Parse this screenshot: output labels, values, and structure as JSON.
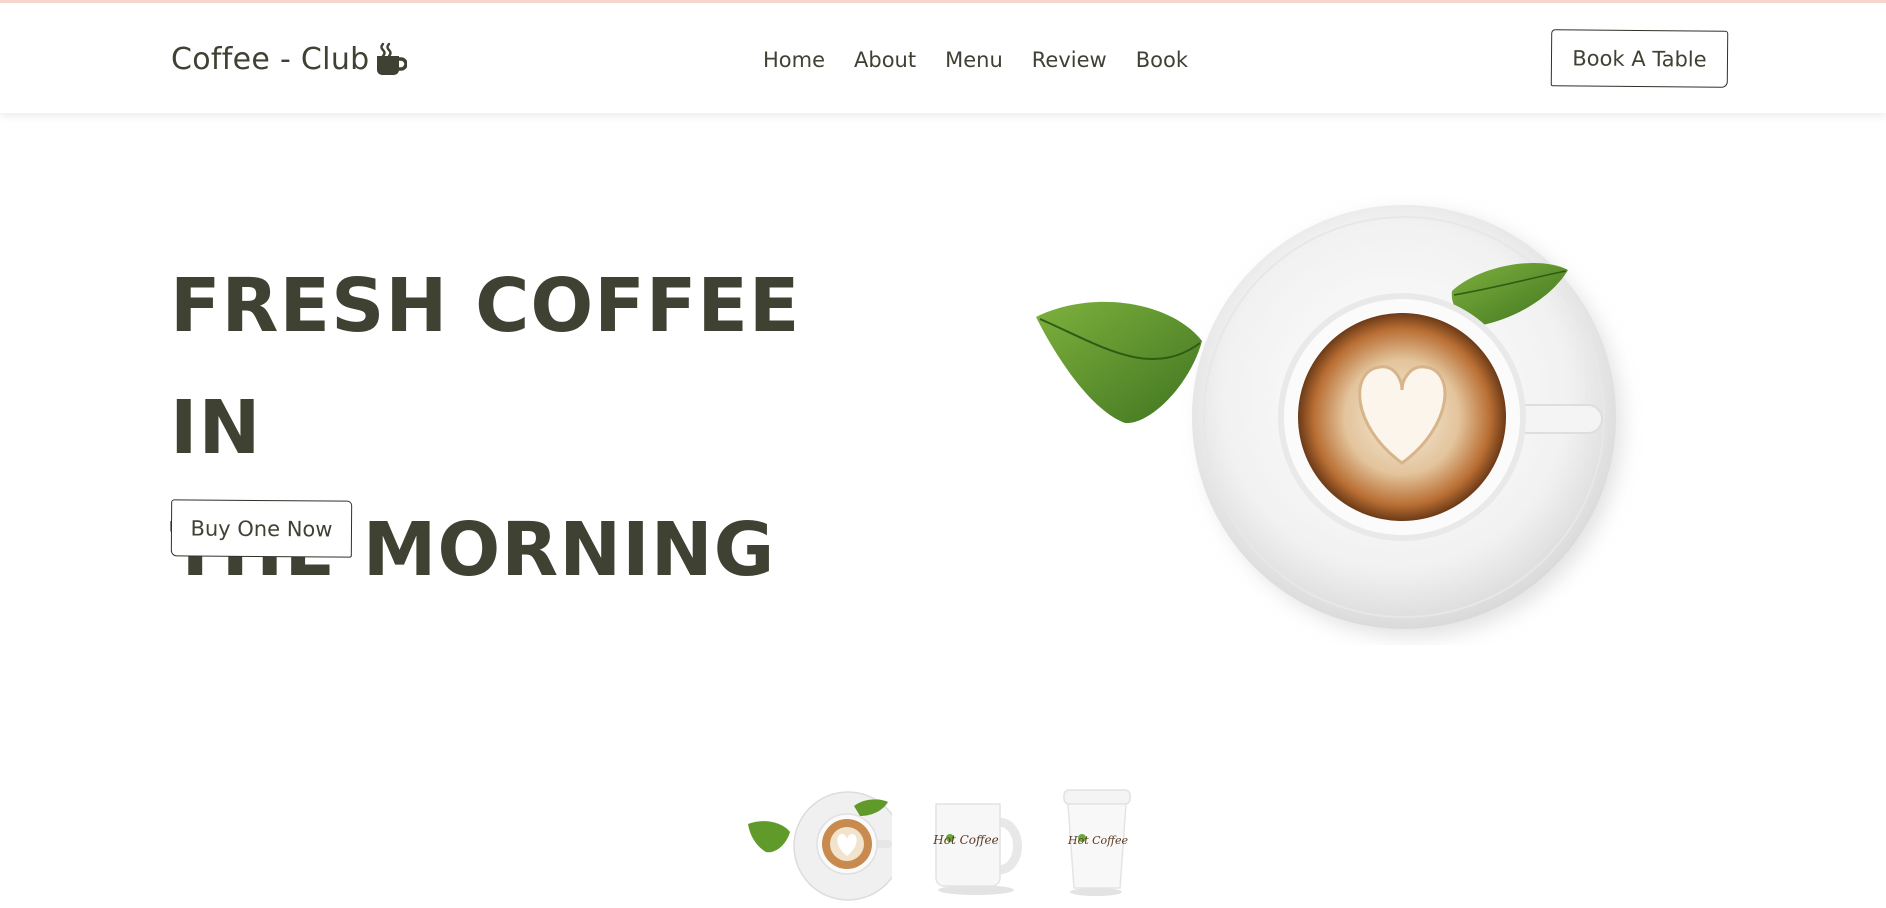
{
  "header": {
    "logo_text": "Coffee - Club",
    "logo_icon": "coffee-mug-icon",
    "nav": [
      {
        "label": "Home"
      },
      {
        "label": "About"
      },
      {
        "label": "Menu"
      },
      {
        "label": "Review"
      },
      {
        "label": "Book"
      }
    ],
    "cta_label": "Book A Table"
  },
  "hero": {
    "title_line1": "FRESH COFFEE IN",
    "title_line2": "THE MORNING",
    "button_label": "Buy One Now",
    "image": "latte-cup-with-leaves"
  },
  "thumbnails": [
    {
      "name": "latte-cup-thumb",
      "selected": true
    },
    {
      "name": "hot-coffee-mug-thumb",
      "label": "Hot Coffee"
    },
    {
      "name": "hot-coffee-takeaway-cup-thumb",
      "label": "Hot Coffee"
    }
  ],
  "colors": {
    "text": "#3f4233",
    "top_line": "#f6d8cf",
    "leaf": "#5a8f2a",
    "foam": "#f3e7d6",
    "crema": "#b5682b"
  }
}
